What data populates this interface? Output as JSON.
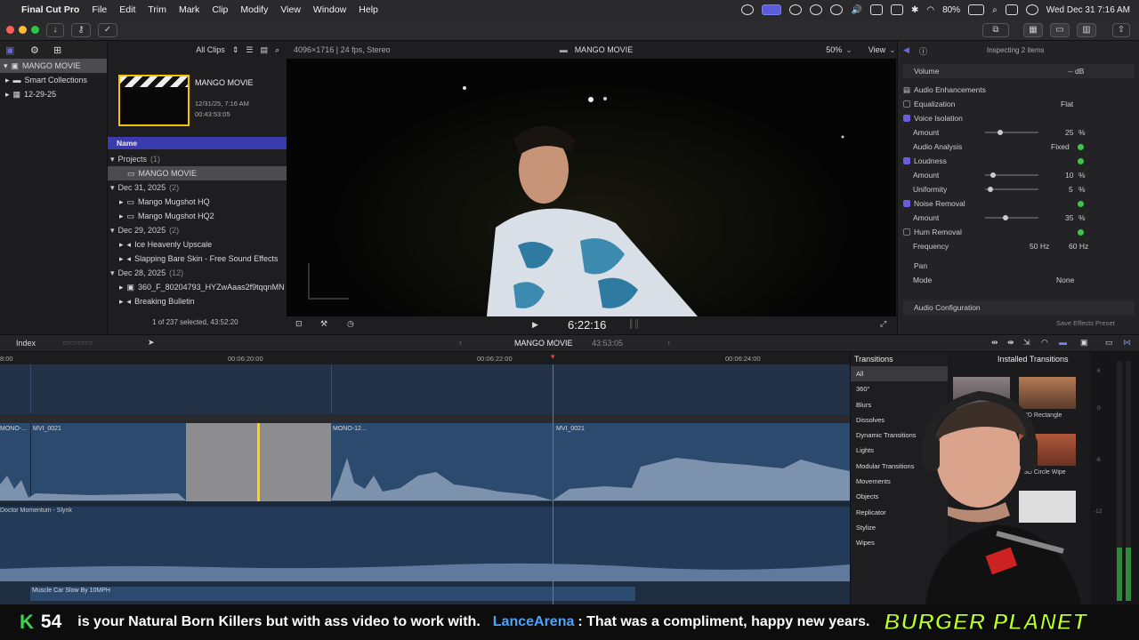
{
  "menubar": {
    "app": "Final Cut Pro",
    "items": [
      "File",
      "Edit",
      "Trim",
      "Mark",
      "Clip",
      "Modify",
      "View",
      "Window",
      "Help"
    ],
    "battery": "80%",
    "clock": "Wed Dec 31  7:16 AM"
  },
  "library": {
    "root": "MANGO MOVIE",
    "smart": "Smart Collections",
    "event": "12-29-25"
  },
  "browser": {
    "filter": "All Clips",
    "clip_title": "MANGO MOVIE",
    "clip_date": "12/31/25, 7:16 AM",
    "clip_duration": "00:43:53:05",
    "column": "Name",
    "rows": [
      {
        "label": "Projects",
        "count": "(1)",
        "type": "group"
      },
      {
        "label": "MANGO MOVIE",
        "count": "",
        "type": "selected"
      },
      {
        "label": "Dec 31, 2025",
        "count": "(2)",
        "type": "group"
      },
      {
        "label": "Mango Mugshot HQ",
        "count": "",
        "type": "item"
      },
      {
        "label": "Mango Mugshot HQ2",
        "count": "",
        "type": "item"
      },
      {
        "label": "Dec 29, 2025",
        "count": "(2)",
        "type": "group"
      },
      {
        "label": "Ice Heavenly Upscale",
        "count": "",
        "type": "item"
      },
      {
        "label": "Slapping Bare Skin - Free Sound Effects",
        "count": "",
        "type": "item"
      },
      {
        "label": "Dec 28, 2025",
        "count": "(12)",
        "type": "group"
      },
      {
        "label": "360_F_80204793_HYZwAaas2f9tqqnMN",
        "count": "",
        "type": "item"
      },
      {
        "label": "Breaking Bulletin",
        "count": "",
        "type": "item"
      }
    ],
    "status": "1 of 237 selected, 43:52:20"
  },
  "viewer": {
    "format": "4096×1716 | 24 fps, Stereo",
    "title": "MANGO MOVIE",
    "zoom": "50%",
    "view": "View",
    "timecode": "6:22:16"
  },
  "inspector": {
    "header": "Inspecting 2 items",
    "volume_label": "Volume",
    "volume_value": "-- dB",
    "enh": "Audio Enhancements",
    "equalization": "Equalization",
    "eq_value": "Flat",
    "voice_isolation": "Voice Isolation",
    "amount": "Amount",
    "vi_amount": "25",
    "pct": "%",
    "audio_analysis": "Audio Analysis",
    "fixed": "Fixed",
    "loudness": "Loudness",
    "loud_amount": "10",
    "uniformity": "Uniformity",
    "uniformity_value": "5",
    "noise_removal": "Noise Removal",
    "nr_amount": "35",
    "hum_removal": "Hum Removal",
    "frequency": "Frequency",
    "hz50": "50 Hz",
    "hz60": "60 Hz",
    "pan": "Pan",
    "mode": "Mode",
    "mode_value": "None",
    "audio_config": "Audio Configuration",
    "save_preset": "Save Effects Preset"
  },
  "timeline": {
    "index": "Index",
    "project": "MANGO MOVIE",
    "duration": "43:53:05",
    "ruler": [
      "8:00",
      "00:06:20:00",
      "00:06:22:00",
      "00:06:24:00"
    ],
    "clips": [
      "MONO-...",
      "MVI_0021",
      "MONO-12...",
      "MVI_0021"
    ],
    "music1": "Doctor Momentum - Slynk",
    "music2": "Muscle Car Slow By 10MPH"
  },
  "transitions": {
    "title": "Transitions",
    "installed": "Installed Transitions",
    "categories": [
      "All",
      "360°",
      "Blurs",
      "Dissolves",
      "Dynamic Transitions",
      "Lights",
      "Modular Transitions",
      "Movements",
      "Objects",
      "Replicator",
      "Stylize",
      "Wipes"
    ],
    "thumb1": "3D Rectangle",
    "thumb2": "3D Circle Wipe",
    "meters": [
      "6",
      "0",
      "-6",
      "-12"
    ]
  },
  "ticker": {
    "k": "K",
    "count": "54",
    "text": "is your Natural Born Killers but with ass video to work with.",
    "user": "LanceArena",
    "msg": ": That was a compliment, happy new years.",
    "brand": "BURGER PLANET"
  },
  "colors": {
    "accent": "#5a5ad6",
    "playhead": "#e0493c",
    "clip": "#2c4a6e",
    "selection": "#ffd400"
  }
}
